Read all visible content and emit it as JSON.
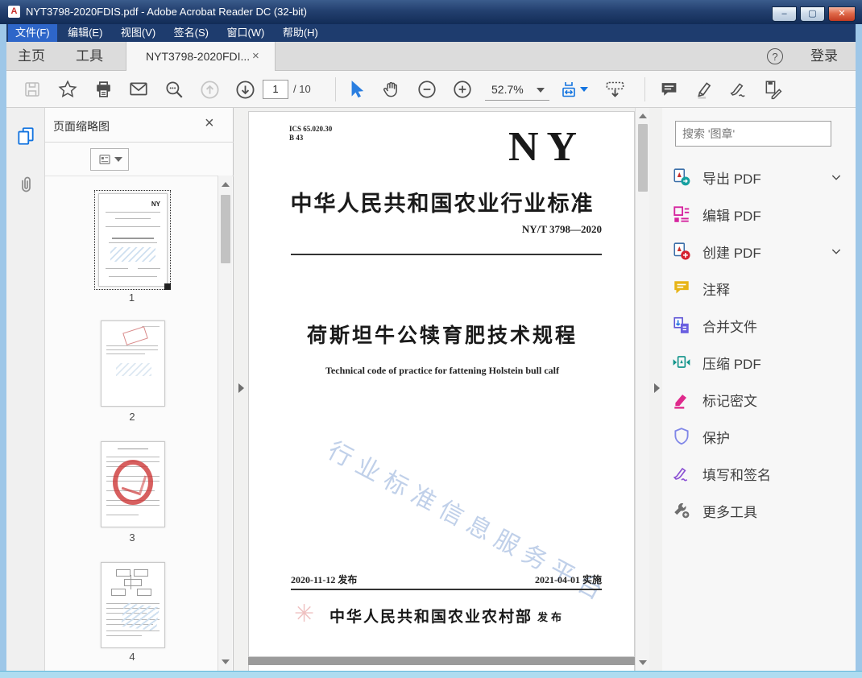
{
  "window": {
    "title": "NYT3798-2020FDIS.pdf - Adobe Acrobat Reader DC (32-bit)",
    "controls": {
      "minimize": "–",
      "maximize": "▢",
      "close": "✕"
    }
  },
  "colors": {
    "accent_blue": "#1374e0",
    "titlebar_navy": "#1e3c6e",
    "close_red": "#c23b22",
    "watermark_blue": "#b7cbe8"
  },
  "menu": {
    "items": [
      "文件(F)",
      "编辑(E)",
      "视图(V)",
      "签名(S)",
      "窗口(W)",
      "帮助(H)"
    ]
  },
  "tabs": {
    "home": "主页",
    "tools": "工具",
    "doc": "NYT3798-2020FDI...",
    "doc_close": "×",
    "help": "?",
    "login": "登录"
  },
  "toolbar": {
    "page_current": "1",
    "page_total": "/ 10",
    "zoom_level": "52.7%"
  },
  "left_panel": {
    "title": "页面缩略图",
    "close": "×",
    "thumbnails": [
      {
        "label": "1",
        "selected": true
      },
      {
        "label": "2",
        "selected": false
      },
      {
        "label": "3",
        "selected": false
      },
      {
        "label": "4",
        "selected": false
      }
    ]
  },
  "document": {
    "ics": "ICS 65.020.30",
    "class_code": "B 43",
    "logo": "NY",
    "standard_heading": "中华人民共和国农业行业标准",
    "standard_number": "NY/T 3798—2020",
    "title_cn": "荷斯坦牛公犊育肥技术规程",
    "title_en": "Technical code of practice for fattening Holstein bull calf",
    "watermark": "行业标准信息服务平台",
    "issue_date": "2020-11-12 发布",
    "implement_date": "2021-04-01 实施",
    "publisher": "中华人民共和国农业农村部",
    "publish_label": "发布"
  },
  "right_panel": {
    "search_placeholder": "搜索 '图章'",
    "tools": [
      {
        "label": "导出 PDF",
        "has_chevron": true
      },
      {
        "label": "编辑 PDF",
        "has_chevron": false
      },
      {
        "label": "创建 PDF",
        "has_chevron": true
      },
      {
        "label": "注释",
        "has_chevron": false
      },
      {
        "label": "合并文件",
        "has_chevron": false
      },
      {
        "label": "压缩 PDF",
        "has_chevron": false
      },
      {
        "label": "标记密文",
        "has_chevron": false
      },
      {
        "label": "保护",
        "has_chevron": false
      },
      {
        "label": "填写和签名",
        "has_chevron": false
      },
      {
        "label": "更多工具",
        "has_chevron": false
      }
    ]
  }
}
